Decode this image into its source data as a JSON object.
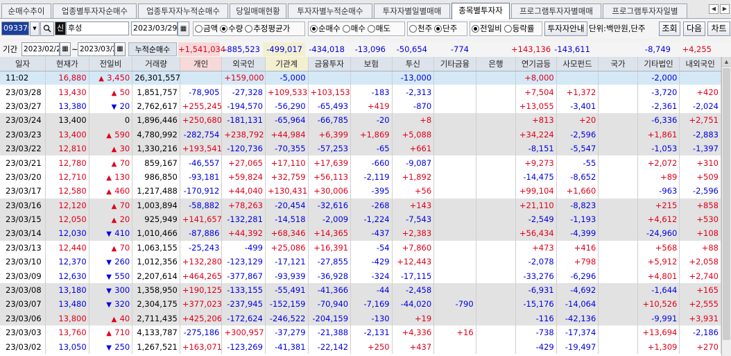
{
  "tabs": [
    "순매수추이",
    "업종별투자자순매수",
    "업종투자자누적순매수",
    "당일매매현황",
    "투자자별누적순매수",
    "투자자별일별매매",
    "종목별투자자",
    "프로그램투자자별매매",
    "프로그램투자자일별"
  ],
  "active_tab": "종목별투자자",
  "nav": {
    "prev": "◀",
    "next": "▶"
  },
  "toolbar": {
    "stock_code": "093370",
    "search_icon": "search-icon",
    "credit_badge": "신",
    "stock_name": "후성",
    "date": "2023/03/29",
    "qty_group": [
      {
        "label": "금액",
        "on": false
      },
      {
        "label": "수량",
        "on": true
      },
      {
        "label": "추정평균가",
        "on": false
      }
    ],
    "trade_group": [
      {
        "label": "순매수",
        "on": true
      },
      {
        "label": "매수",
        "on": false
      },
      {
        "label": "매도",
        "on": false
      }
    ],
    "unit_group": [
      {
        "label": "천주",
        "on": false
      },
      {
        "label": "단주",
        "on": true
      }
    ],
    "ratio_group": [
      {
        "label": "전일비",
        "on": true
      },
      {
        "label": "등락률",
        "on": false
      }
    ],
    "guide_btn": "투자자안내",
    "unit_text": "단위:백만원,단주",
    "search_btn": "조회",
    "next_btn": "다음",
    "chart_btn": "차트"
  },
  "period": {
    "label": "기간",
    "from": "2023/02/28",
    "tilde": "~",
    "to": "2023/03/29",
    "sum_label": "누적순매수",
    "sums": [
      "+1,541,034",
      "-885,523",
      "-499,017",
      "-434,018",
      "-13,096",
      "-50,654",
      "-774",
      "",
      "+143,136",
      "-143,611",
      "",
      "-8,749",
      "+4,255"
    ]
  },
  "columns": [
    "일자",
    "현재가",
    "전일비",
    "거래량",
    "개인",
    "외국인",
    "기관계",
    "금융투자",
    "보험",
    "투신",
    "기타금융",
    "은행",
    "연기금등",
    "사모펀드",
    "국가",
    "기타법인",
    "내외국인"
  ],
  "rows": [
    {
      "date": "11:02",
      "price": "16,880",
      "dir": "up",
      "chg": "3,450",
      "vol": "26,301,557",
      "v": [
        "",
        "+159,000",
        "-5,000",
        "",
        "",
        "-13,000",
        "",
        "",
        "+8,000",
        "",
        "",
        "-2,000",
        ""
      ]
    },
    {
      "date": "23/03/28",
      "price": "13,430",
      "dir": "up",
      "chg": "50",
      "vol": "1,851,757",
      "v": [
        "-78,905",
        "-27,328",
        "+109,533",
        "+103,153",
        "-183",
        "-2,313",
        "",
        "",
        "+7,504",
        "+1,372",
        "",
        "-3,720",
        "+420"
      ]
    },
    {
      "date": "23/03/27",
      "price": "13,380",
      "dir": "down",
      "chg": "20",
      "vol": "2,762,617",
      "v": [
        "+255,245",
        "-194,570",
        "-56,290",
        "-65,493",
        "+419",
        "-870",
        "",
        "",
        "+13,055",
        "-3,401",
        "",
        "-2,361",
        "-2,024"
      ]
    },
    {
      "date": "23/03/24",
      "price": "13,400",
      "dir": "none",
      "chg": "0",
      "vol": "1,896,446",
      "v": [
        "+250,680",
        "-181,131",
        "-65,964",
        "-66,785",
        "-20",
        "+8",
        "",
        "",
        "+813",
        "+20",
        "",
        "-6,336",
        "+2,751"
      ]
    },
    {
      "date": "23/03/23",
      "price": "13,400",
      "dir": "up",
      "chg": "590",
      "vol": "4,780,992",
      "v": [
        "-282,754",
        "+238,792",
        "+44,984",
        "+6,399",
        "+1,869",
        "+5,088",
        "",
        "",
        "+34,224",
        "-2,596",
        "",
        "+1,861",
        "-2,883"
      ]
    },
    {
      "date": "23/03/22",
      "price": "12,810",
      "dir": "up",
      "chg": "30",
      "vol": "1,330,216",
      "v": [
        "+193,541",
        "-120,736",
        "-70,355",
        "-57,253",
        "-65",
        "+661",
        "",
        "",
        "-8,151",
        "-5,547",
        "",
        "-1,053",
        "-1,397"
      ]
    },
    {
      "date": "23/03/21",
      "price": "12,780",
      "dir": "up",
      "chg": "70",
      "vol": "859,167",
      "v": [
        "-46,557",
        "+27,065",
        "+17,110",
        "+17,639",
        "-660",
        "-9,087",
        "",
        "",
        "+9,273",
        "-55",
        "",
        "+2,072",
        "+310"
      ]
    },
    {
      "date": "23/03/20",
      "price": "12,710",
      "dir": "up",
      "chg": "130",
      "vol": "986,850",
      "v": [
        "-93,181",
        "+59,824",
        "+32,759",
        "+56,113",
        "-2,119",
        "+1,892",
        "",
        "",
        "-14,475",
        "-8,652",
        "",
        "+89",
        "+509"
      ]
    },
    {
      "date": "23/03/17",
      "price": "12,580",
      "dir": "up",
      "chg": "460",
      "vol": "1,217,488",
      "v": [
        "-170,912",
        "+44,040",
        "+130,431",
        "+30,006",
        "-395",
        "+56",
        "",
        "",
        "+99,104",
        "+1,660",
        "",
        "-963",
        "-2,596"
      ]
    },
    {
      "date": "23/03/16",
      "price": "12,120",
      "dir": "up",
      "chg": "70",
      "vol": "1,003,894",
      "v": [
        "-58,882",
        "+78,263",
        "-20,454",
        "-32,616",
        "-268",
        "+143",
        "",
        "",
        "+21,110",
        "-8,823",
        "",
        "+215",
        "+858"
      ]
    },
    {
      "date": "23/03/15",
      "price": "12,050",
      "dir": "up",
      "chg": "20",
      "vol": "925,949",
      "v": [
        "+141,657",
        "-132,281",
        "-14,518",
        "-2,009",
        "-1,224",
        "-7,543",
        "",
        "",
        "-2,549",
        "-1,193",
        "",
        "+4,612",
        "+530"
      ]
    },
    {
      "date": "23/03/14",
      "price": "12,030",
      "dir": "down",
      "chg": "410",
      "vol": "1,010,466",
      "v": [
        "-87,886",
        "+44,392",
        "+68,346",
        "+14,365",
        "-437",
        "+2,383",
        "",
        "",
        "+56,434",
        "-4,399",
        "",
        "-24,960",
        "+108"
      ]
    },
    {
      "date": "23/03/13",
      "price": "12,440",
      "dir": "up",
      "chg": "70",
      "vol": "1,063,155",
      "v": [
        "-25,243",
        "-499",
        "+25,086",
        "+16,391",
        "-54",
        "+7,860",
        "",
        "",
        "+473",
        "+416",
        "",
        "+568",
        "+88"
      ]
    },
    {
      "date": "23/03/10",
      "price": "12,370",
      "dir": "down",
      "chg": "260",
      "vol": "1,012,356",
      "v": [
        "+132,280",
        "-123,129",
        "-17,121",
        "-27,855",
        "-429",
        "+12,443",
        "",
        "",
        "-2,078",
        "+798",
        "",
        "+5,912",
        "+2,058"
      ]
    },
    {
      "date": "23/03/09",
      "price": "12,630",
      "dir": "down",
      "chg": "550",
      "vol": "2,207,614",
      "v": [
        "+464,265",
        "-377,867",
        "-93,939",
        "-36,928",
        "-324",
        "-17,115",
        "",
        "",
        "-33,276",
        "-6,296",
        "",
        "+4,801",
        "+2,740"
      ]
    },
    {
      "date": "23/03/08",
      "price": "13,180",
      "dir": "down",
      "chg": "300",
      "vol": "1,358,950",
      "v": [
        "+190,125",
        "-133,155",
        "-55,491",
        "-41,366",
        "-44",
        "-2,458",
        "",
        "",
        "-6,931",
        "-4,692",
        "",
        "-1,644",
        "+165"
      ]
    },
    {
      "date": "23/03/07",
      "price": "13,480",
      "dir": "down",
      "chg": "320",
      "vol": "2,304,175",
      "v": [
        "+377,023",
        "-237,945",
        "-152,159",
        "-70,940",
        "-7,169",
        "-44,020",
        "-790",
        "",
        "-15,176",
        "-14,064",
        "",
        "+10,526",
        "+2,555"
      ]
    },
    {
      "date": "23/03/06",
      "price": "13,800",
      "dir": "up",
      "chg": "40",
      "vol": "2,711,435",
      "v": [
        "+425,206",
        "-172,624",
        "-246,522",
        "-204,159",
        "-130",
        "+19",
        "",
        "",
        "-116",
        "-42,136",
        "",
        "-9,991",
        "+3,931"
      ]
    },
    {
      "date": "23/03/03",
      "price": "13,760",
      "dir": "up",
      "chg": "710",
      "vol": "4,133,787",
      "v": [
        "-275,186",
        "+300,957",
        "-37,279",
        "-21,388",
        "-2,131",
        "+4,336",
        "+16",
        "",
        "-738",
        "-17,374",
        "",
        "+13,694",
        "-2,186"
      ]
    },
    {
      "date": "23/03/02",
      "price": "13,050",
      "dir": "down",
      "chg": "250",
      "vol": "1,267,521",
      "v": [
        "+163,071",
        "-123,269",
        "-41,381",
        "-22,142",
        "+250",
        "+437",
        "",
        "",
        "-429",
        "-19,497",
        "",
        "+1,309",
        "+270"
      ]
    }
  ],
  "arrows": {
    "up": "▲",
    "down": "▼"
  },
  "colors": {
    "up": "#e0001a",
    "down": "#0000e0",
    "stripe": "#e2e2e2",
    "current_row": "#d4e8f6",
    "header": "#dde3ea"
  }
}
